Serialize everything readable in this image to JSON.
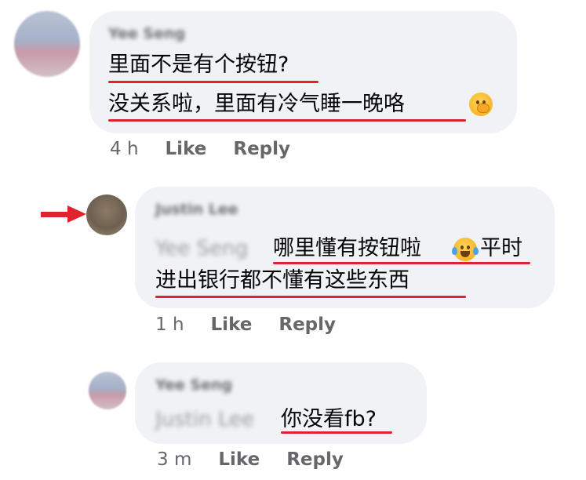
{
  "comments": [
    {
      "author": "Yee Seng",
      "lines": [
        "里面不是有个按钮?",
        "没关系啦，里面有冷气睡一晚咯"
      ],
      "emoji": "hand-over-mouth-emoji",
      "time": "4 h",
      "like": "Like",
      "reply": "Reply"
    },
    {
      "author": "Justin Lee",
      "mention": "Yee Seng",
      "lines": [
        "哪里懂有按钮啦",
        "平时",
        "进出银行都不懂有这些东西"
      ],
      "emoji": "tears-of-joy-emoji",
      "time": "1 h",
      "like": "Like",
      "reply": "Reply"
    },
    {
      "author": "Yee Seng",
      "mention": "Justin Lee",
      "lines": [
        "你没看fb?"
      ],
      "time": "3 m",
      "like": "Like",
      "reply": "Reply"
    }
  ],
  "colors": {
    "bubble": "#f0f2f5",
    "underline": "#e0222c",
    "arrow": "#e0222c",
    "meta": "#65676b"
  }
}
